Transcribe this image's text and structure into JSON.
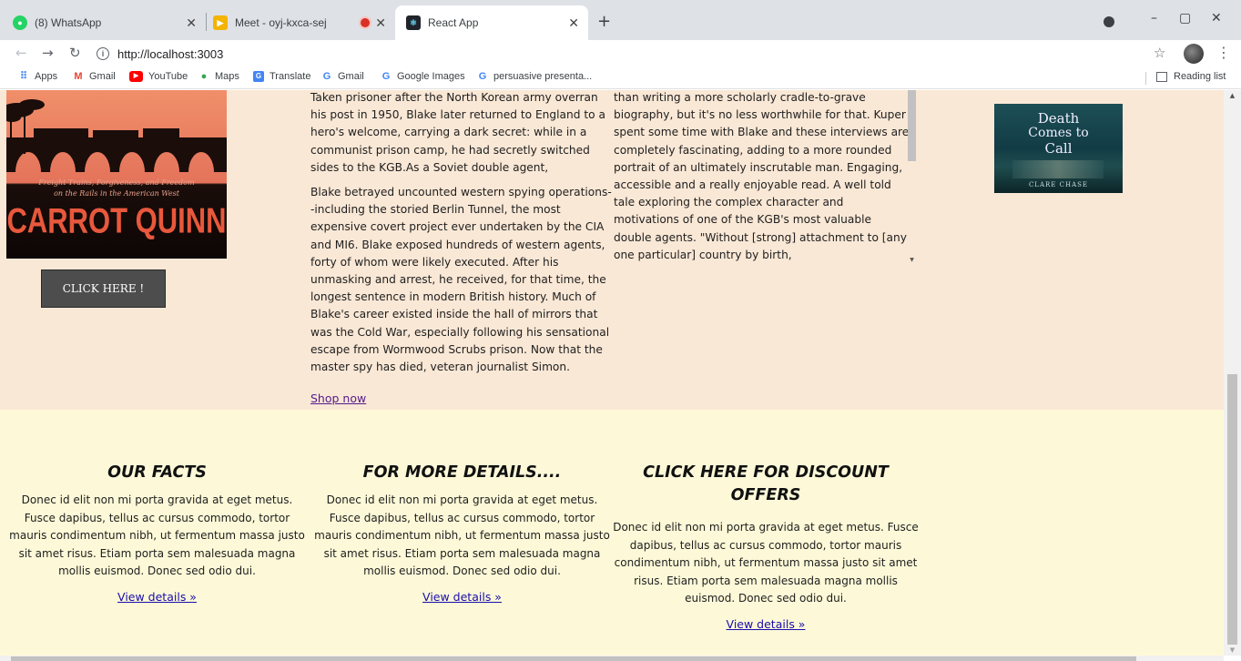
{
  "browser": {
    "tabs": [
      {
        "title": "(8) WhatsApp",
        "badge": "8",
        "color": "#25d366"
      },
      {
        "title": "Meet - oyj-kxca-sej",
        "color": "#f4b400"
      },
      {
        "title": "React App",
        "color": "#20232a"
      }
    ],
    "new_tab": "+",
    "window_controls": {
      "minimize": "–",
      "maximize": "▢",
      "close": "✕"
    },
    "url": "http://localhost:3003",
    "info_icon": "i",
    "bookmarks": [
      {
        "label": "Apps",
        "icon": "apps-grid-icon",
        "glyph": "⠿",
        "color": "#4285f4"
      },
      {
        "label": "Gmail",
        "icon": "gmail-icon",
        "glyph": "M",
        "color": "#ea4335"
      },
      {
        "label": "YouTube",
        "icon": "youtube-icon",
        "glyph": "▶",
        "color": "#ff0000"
      },
      {
        "label": "Maps",
        "icon": "maps-pin-icon",
        "glyph": "●",
        "color": "#34a853"
      },
      {
        "label": "Translate",
        "icon": "translate-icon",
        "glyph": "G",
        "color": "#4285f4"
      },
      {
        "label": "Gmail",
        "icon": "google-icon",
        "glyph": "G",
        "color": "#4285f4"
      },
      {
        "label": "Google Images",
        "icon": "google-icon",
        "glyph": "G",
        "color": "#4285f4"
      },
      {
        "label": "persuasive presenta...",
        "icon": "google-icon",
        "glyph": "G",
        "color": "#4285f4"
      }
    ],
    "reading_list": "Reading list"
  },
  "page": {
    "book1": {
      "subtitle_line1": "Freight Trains, Forgiveness, and Freedom",
      "subtitle_line2": "on the Rails in the American West",
      "author": "CARROT QUINN"
    },
    "click_button": "CLICK HERE !",
    "description": {
      "para1": "Taken prisoner after the North Korean army overran his post in 1950, Blake later returned to England to a hero's welcome, carrying a dark secret: while in a communist prison camp, he had secretly switched sides to the KGB.As a Soviet double agent,",
      "para2": "Blake betrayed uncounted western spying operations--including the storied Berlin Tunnel, the most expensive covert project ever undertaken by the CIA and MI6. Blake exposed hundreds of western agents, forty of whom were likely executed. After his unmasking and arrest, he received, for that time, the longest sentence in modern British history. Much of Blake's career existed inside the hall of mirrors that was the Cold War, especially following his sensational escape from Wormwood Scrubs prison. Now that the master spy has died, veteran journalist Simon.",
      "shop_link": "Shop now"
    },
    "review": {
      "text": "than writing a more scholarly cradle-to-grave biography, but it's no less worthwhile for that. Kuper spent some time with Blake and these interviews are completely fascinating, adding to a more rounded portrait of an ultimately inscrutable man. Engaging, accessible and a really enjoyable read. A well told tale exploring the complex character and motivations of one of the KGB's most valuable double agents. \"Without [strong] attachment to [any one particular] country by birth,"
    },
    "book2": {
      "line1": "Death",
      "line2": "Comes to",
      "line3": "Call",
      "author": "CLARE CHASE"
    },
    "facts": [
      {
        "title": "OUR FACTS",
        "body": "Donec id elit non mi porta gravida at eget metus. Fusce dapibus, tellus ac cursus commodo, tortor mauris condimentum nibh, ut fermentum massa justo sit amet risus. Etiam porta sem malesuada magna mollis euismod. Donec sed odio dui.",
        "link": "View details »"
      },
      {
        "title": "FOR MORE DETAILS....",
        "body": "Donec id elit non mi porta gravida at eget metus. Fusce dapibus, tellus ac cursus commodo, tortor mauris condimentum nibh, ut fermentum massa justo sit amet risus. Etiam porta sem malesuada magna mollis euismod. Donec sed odio dui.",
        "link": "View details »"
      },
      {
        "title": "CLICK HERE FOR DISCOUNT OFFERS",
        "body": "Donec id elit non mi porta gravida at eget metus. Fusce dapibus, tellus ac cursus commodo, tortor mauris condimentum nibh, ut fermentum massa justo sit amet risus. Etiam porta sem malesuada magna mollis euismod. Donec sed odio dui.",
        "link": "View details »"
      }
    ]
  },
  "colors": {
    "upper_bg": "#fae8d6",
    "lower_bg": "#fdf9d8",
    "link_visited": "#551a8b",
    "link": "#1a0dab"
  }
}
